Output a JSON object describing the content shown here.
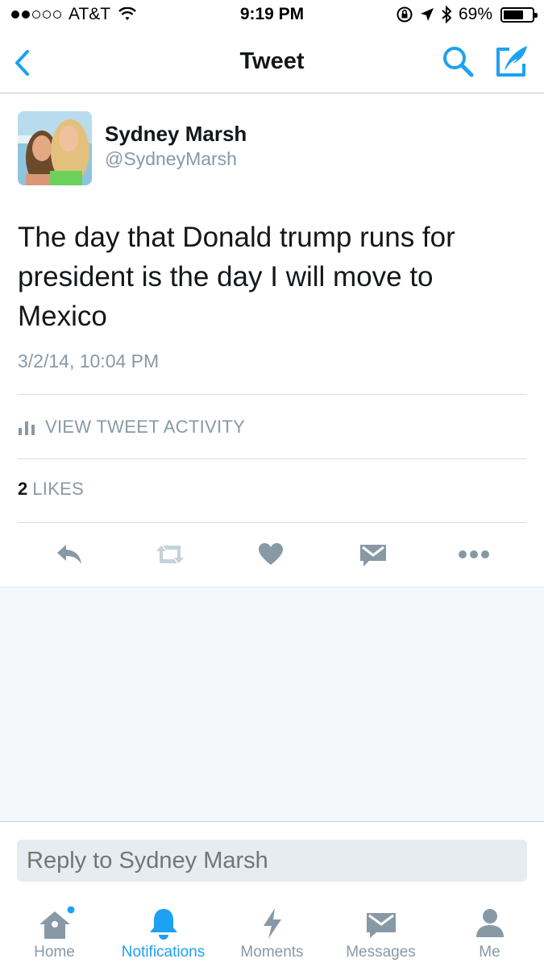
{
  "status_bar": {
    "carrier": "AT&T",
    "time": "9:19 PM",
    "battery": "69%",
    "signal_bars_filled": 2,
    "signal_bars_total": 5
  },
  "nav": {
    "title": "Tweet",
    "back_icon": "chevron-left-icon",
    "search_icon": "search-icon",
    "compose_icon": "compose-tweet-icon"
  },
  "tweet": {
    "author_name": "Sydney Marsh",
    "author_handle": "@SydneyMarsh",
    "text": "The day that Donald trump runs for president is the day I will move to Mexico",
    "timestamp": "3/2/14, 10:04 PM",
    "activity_label": "VIEW TWEET ACTIVITY",
    "likes_count": "2",
    "likes_label": "LIKES"
  },
  "actions": [
    "reply-icon",
    "retweet-icon",
    "like-icon",
    "direct-message-icon",
    "more-icon"
  ],
  "reply": {
    "placeholder": "Reply to Sydney Marsh"
  },
  "tabs": [
    {
      "label": "Home",
      "icon": "home-icon"
    },
    {
      "label": "Notifications",
      "icon": "bell-icon"
    },
    {
      "label": "Moments",
      "icon": "lightning-icon"
    },
    {
      "label": "Messages",
      "icon": "envelope-icon"
    },
    {
      "label": "Me",
      "icon": "person-icon"
    }
  ],
  "colors": {
    "accent": "#1da1f2",
    "muted": "#8899a6",
    "text": "#14171a",
    "icon_gray": "#8899a6"
  }
}
